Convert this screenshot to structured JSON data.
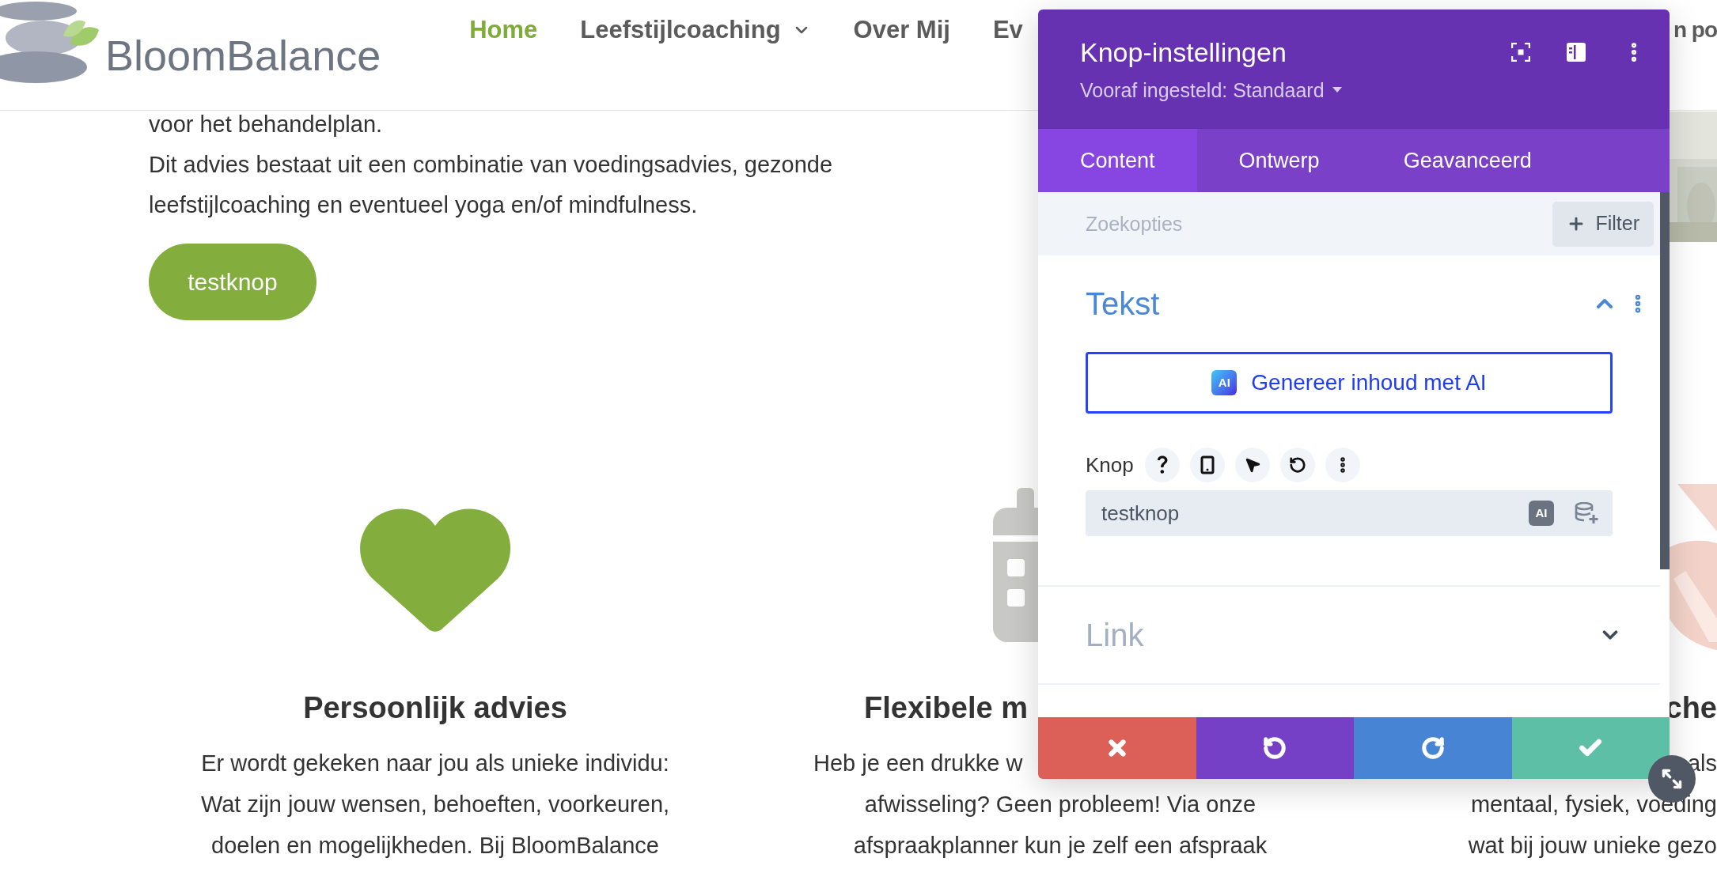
{
  "header": {
    "logo": "BloomBalance",
    "nav": [
      {
        "label": "Home",
        "selected": true,
        "has_dropdown": false
      },
      {
        "label": "Leefstijlcoaching",
        "selected": false,
        "has_dropdown": true
      },
      {
        "label": "Over Mij",
        "selected": false,
        "has_dropdown": false
      },
      {
        "label": "Ev",
        "selected": false,
        "has_dropdown": false
      }
    ],
    "nav_edge_text": "n po"
  },
  "intro": {
    "lines": [
      "voor het behandelplan.",
      "Dit advies bestaat uit een combinatie van voedingsadvies, gezonde",
      "leefstijlcoaching en eventueel yoga en/of mindfulness."
    ],
    "button": "testknop"
  },
  "features": [
    {
      "title": "Persoonlijk advies",
      "lines": [
        "Er wordt gekeken naar jou als unieke individu:",
        "Wat zijn jouw wensen, behoeften, voorkeuren,",
        "doelen en mogelijkheden. Bij BloomBalance"
      ]
    },
    {
      "title": "Flexibele m",
      "lines": [
        "Heb je een drukke w",
        "afwisseling? Geen probleem! Via onze",
        "afspraakplanner kun je zelf een afspraak"
      ]
    },
    {
      "title": "che",
      "lines": [
        "als",
        "mentaal, fysiek, voeding",
        "wat bij jouw unieke gezo"
      ]
    }
  ],
  "settings_panel": {
    "title": "Knop-instellingen",
    "preset": "Vooraf ingesteld: Standaard",
    "tabs": [
      {
        "label": "Content",
        "selected": true
      },
      {
        "label": "Ontwerp",
        "selected": false
      },
      {
        "label": "Geavanceerd",
        "selected": false
      }
    ],
    "search": {
      "placeholder": "Zoekopties"
    },
    "filter_button": "Filter",
    "sections": [
      {
        "title": "Tekst",
        "expanded": true,
        "ai_button": {
          "badge": "AI",
          "label": "Genereer inhoud met AI"
        },
        "field": {
          "label": "Knop",
          "value": "testknop",
          "badge": "AI"
        }
      },
      {
        "title": "Link",
        "expanded": false
      }
    ]
  }
}
